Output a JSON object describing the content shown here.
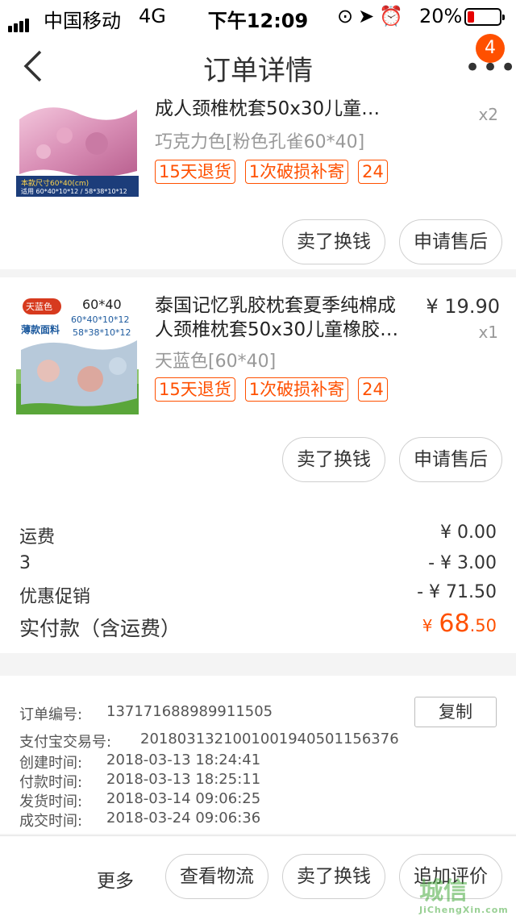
{
  "status_bar": {
    "carrier": "中国移动",
    "network": "4G",
    "time": "下午12:09",
    "battery_text": "20%",
    "icons": [
      "lock-rotation-icon",
      "location-icon",
      "alarm-icon"
    ],
    "battery_level": 0.2
  },
  "nav": {
    "title": "订单详情",
    "more_badge": "4"
  },
  "products": [
    {
      "title": "成人颈椎枕套50x30儿童…",
      "quantity": "x2",
      "sku": "巧克力色[粉色孔雀60*40]",
      "tags": [
        "15天退货",
        "1次破损补寄",
        "24"
      ],
      "thumb": {
        "line1": "本款尺寸60*40(cm)",
        "line2": "适用 60*40*10*12 / 58*38*10*12"
      },
      "buttons": [
        "卖了换钱",
        "申请售后"
      ]
    },
    {
      "title": "泰国记忆乳胶枕套夏季纯棉成人颈椎枕套50x30儿童橡胶…",
      "price": "¥ 19.90",
      "quantity": "x1",
      "sku": "天蓝色[60*40]",
      "tags": [
        "15天退货",
        "1次破损补寄",
        "24"
      ],
      "thumb": {
        "badge": "天蓝色",
        "size": "60*40",
        "label": "薄款面料",
        "dim1": "60*40*10*12",
        "dim2": "58*38*10*12"
      },
      "buttons": [
        "卖了换钱",
        "申请售后"
      ]
    }
  ],
  "summary": {
    "shipping_label": "运费",
    "shipping_value": "¥ 0.00",
    "coupon_label": "3",
    "coupon_value": "- ¥ 3.00",
    "promo_label": "优惠促销",
    "promo_value": "- ¥ 71.50",
    "total_label": "实付款（含运费）",
    "total_currency": "¥",
    "total_int": "68",
    "total_dec": ".50"
  },
  "order_info": {
    "order_no_label": "订单编号:",
    "order_no": "137171688989911505",
    "copy_label": "复制",
    "alipay_label": "支付宝交易号:",
    "alipay_no": "2018031321001001940501156376",
    "created_label": "创建时间:",
    "created": "2018-03-13 18:24:41",
    "paid_label": "付款时间:",
    "paid": "2018-03-13 18:25:11",
    "shipped_label": "发货时间:",
    "shipped": "2018-03-14 09:06:25",
    "done_label": "成交时间:",
    "done": "2018-03-24 09:06:36"
  },
  "bottom_bar": {
    "more": "更多",
    "logistics": "查看物流",
    "sell": "卖了换钱",
    "review": "追加评价"
  },
  "watermark": {
    "text": "城信",
    "sub": "JiChengXin.com"
  },
  "colors": {
    "accent": "#ff5000",
    "page_bg": "#f4f4f4"
  }
}
